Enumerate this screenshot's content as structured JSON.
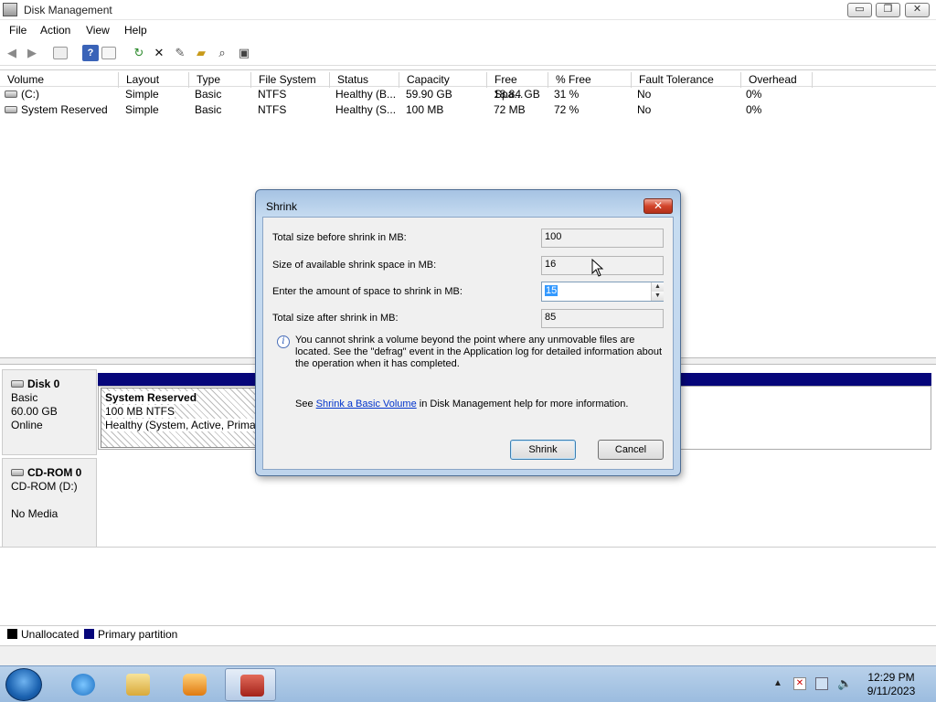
{
  "window": {
    "title": "Disk Management",
    "minimize": "▭",
    "restore": "❐",
    "close": "✕"
  },
  "menu": [
    "File",
    "Action",
    "View",
    "Help"
  ],
  "toolbar": [
    "back-icon",
    "forward-icon",
    "show-hide-icon",
    "help-icon",
    "properties-icon",
    "refresh-icon",
    "delete-icon",
    "settings-icon",
    "open-icon",
    "explore-icon",
    "rescan-icon"
  ],
  "volumes": {
    "headers": [
      "Volume",
      "Layout",
      "Type",
      "File System",
      "Status",
      "Capacity",
      "Free Spa...",
      "% Free",
      "Fault Tolerance",
      "Overhead"
    ],
    "rows": [
      [
        "(C:)",
        "Simple",
        "Basic",
        "NTFS",
        "Healthy (B...",
        "59.90 GB",
        "18.84 GB",
        "31 %",
        "No",
        "0%"
      ],
      [
        "System Reserved",
        "Simple",
        "Basic",
        "NTFS",
        "Healthy (S...",
        "100 MB",
        "72 MB",
        "72 %",
        "No",
        "0%"
      ]
    ]
  },
  "disks": [
    {
      "name": "Disk 0",
      "type": "Basic",
      "size": "60.00 GB",
      "state": "Online"
    },
    {
      "name": "CD-ROM 0",
      "type": "CD-ROM (D:)",
      "size": "",
      "state": "No Media"
    }
  ],
  "partition": {
    "name": "System Reserved",
    "size_fs": "100 MB NTFS",
    "status": "Healthy (System, Active, Primar"
  },
  "legend": [
    {
      "label": "Unallocated",
      "color": "#000000"
    },
    {
      "label": "Primary partition",
      "color": "#06067a"
    }
  ],
  "dialog": {
    "title": "Shrink",
    "close": "✕",
    "total_before_label": "Total size before shrink in MB:",
    "total_before_value": "100",
    "available_label": "Size of available shrink space in MB:",
    "available_value": "16",
    "enter_label": "Enter the amount of space to shrink in MB:",
    "enter_value": "15",
    "total_after_label": "Total size after shrink in MB:",
    "total_after_value": "85",
    "info_text": "You cannot shrink a volume beyond the point where any unmovable files are located. See the \"defrag\" event in the Application log for detailed information about the operation when it has completed.",
    "help_prefix": "See ",
    "help_link": "Shrink a Basic Volume",
    "help_suffix": " in Disk Management help for more information.",
    "shrink_button": "Shrink",
    "cancel_button": "Cancel"
  },
  "taskbar": {
    "time": "12:29 PM",
    "date": "9/11/2023"
  }
}
